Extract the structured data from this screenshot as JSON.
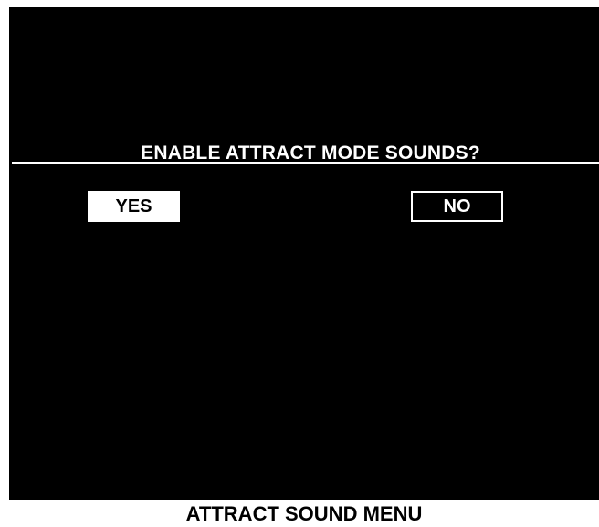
{
  "screen": {
    "prompt": "ENABLE ATTRACT MODE SOUNDS?",
    "options": {
      "yes_label": "YES",
      "no_label": "NO"
    },
    "selected_option": "YES"
  },
  "caption": "ATTRACT SOUND MENU",
  "colors": {
    "screen_background": "#000000",
    "foreground": "#ffffff",
    "page_background": "#ffffff"
  }
}
